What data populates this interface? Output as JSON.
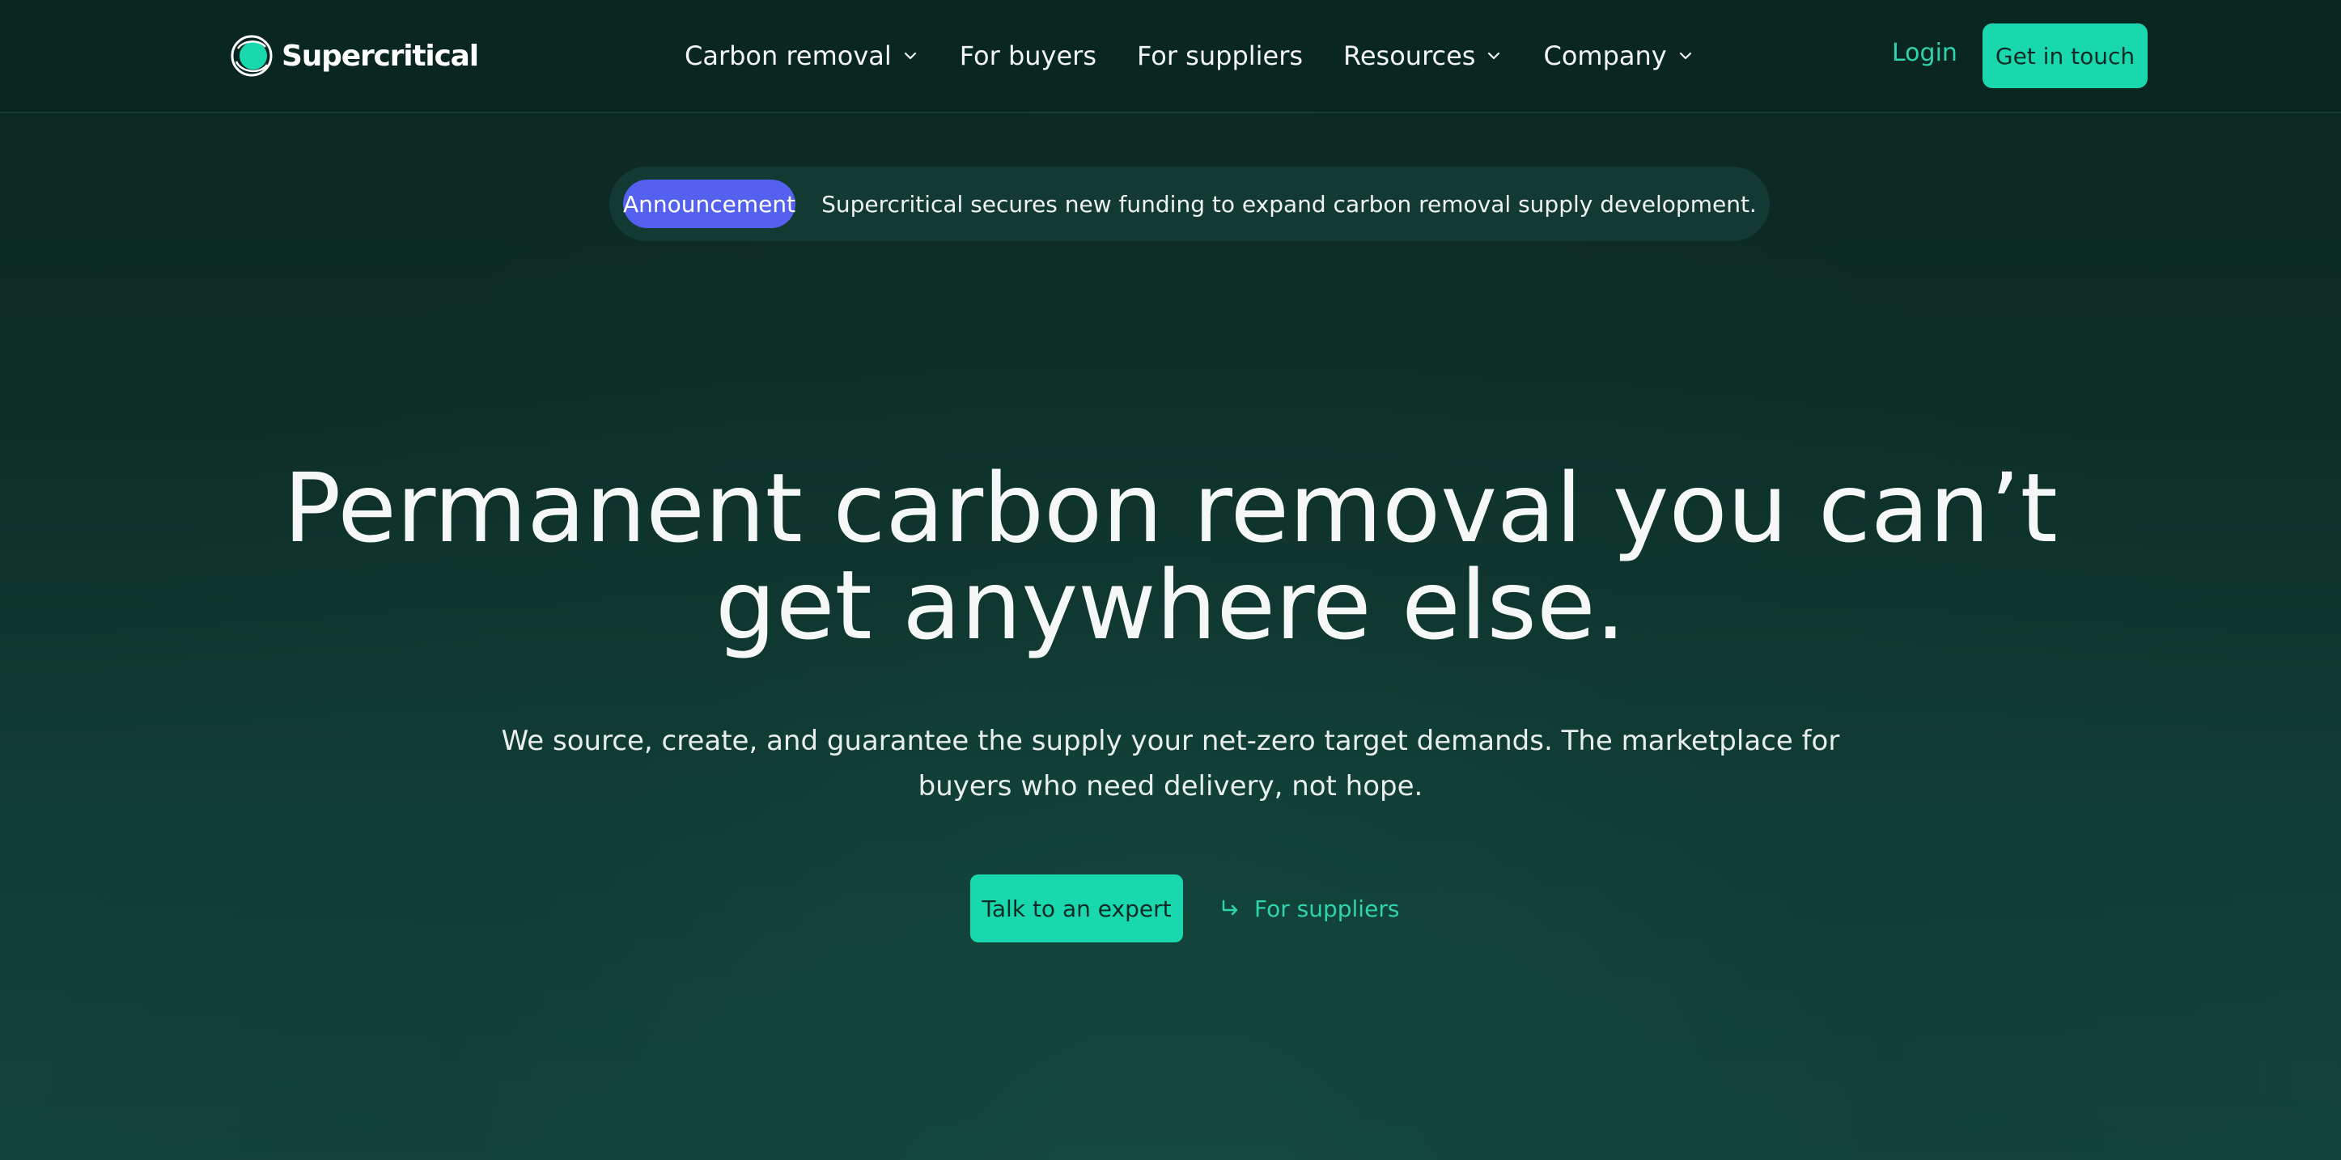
{
  "brand": {
    "name": "Supercritical",
    "logo_icon": "supercritical-logo-icon",
    "colors": {
      "accent": "#19d8ad",
      "accent_text": "#2fd3ae",
      "badge": "#5461ef",
      "background": "#0b2620"
    }
  },
  "nav": {
    "items": [
      {
        "label": "Carbon removal",
        "dropdown": true
      },
      {
        "label": "For buyers",
        "dropdown": false
      },
      {
        "label": "For suppliers",
        "dropdown": false
      },
      {
        "label": "Resources",
        "dropdown": true
      },
      {
        "label": "Company",
        "dropdown": true
      }
    ],
    "login_label": "Login",
    "cta_label": "Get in touch"
  },
  "announcement": {
    "badge": "Announcement",
    "text": "Supercritical secures new funding to expand carbon removal supply development.",
    "icon": "arrow-right-icon"
  },
  "hero": {
    "title_line1": "Permanent carbon removal you can’t",
    "title_line2": "get anywhere else.",
    "subtitle_line1": "We source, create, and guarantee the supply your net-zero target demands. The marketplace for",
    "subtitle_line2": "buyers who need delivery, not hope.",
    "primary_button": "Talk to an expert",
    "secondary_link": "For suppliers",
    "secondary_icon": "return-arrow-icon"
  }
}
